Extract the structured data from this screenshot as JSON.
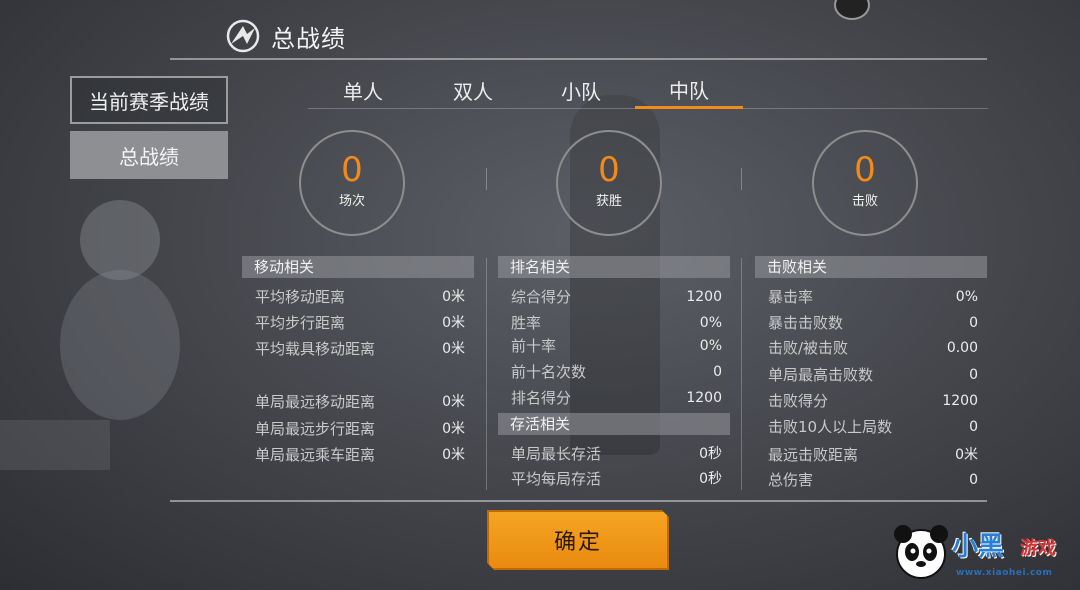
{
  "header": {
    "title": "总战绩"
  },
  "sidebar": {
    "season_label": "当前赛季战绩",
    "total_label": "总战绩"
  },
  "tabs": [
    "单人",
    "双人",
    "小队",
    "中队"
  ],
  "active_tab": "中队",
  "summary": [
    {
      "value": "0",
      "label": "场次"
    },
    {
      "value": "0",
      "label": "获胜"
    },
    {
      "value": "0",
      "label": "击败"
    }
  ],
  "movement": {
    "title": "移动相关",
    "rows": [
      {
        "k": "平均移动距离",
        "v": "0米"
      },
      {
        "k": "平均步行距离",
        "v": "0米"
      },
      {
        "k": "平均载具移动距离",
        "v": "0米"
      },
      {
        "k": "单局最远移动距离",
        "v": "0米"
      },
      {
        "k": "单局最远步行距离",
        "v": "0米"
      },
      {
        "k": "单局最远乘车距离",
        "v": "0米"
      }
    ]
  },
  "ranking": {
    "title": "排名相关",
    "rows": [
      {
        "k": "综合得分",
        "v": "1200"
      },
      {
        "k": "胜率",
        "v": "0%"
      },
      {
        "k": "前十率",
        "v": "0%"
      },
      {
        "k": "前十名次数",
        "v": "0"
      },
      {
        "k": "排名得分",
        "v": "1200"
      }
    ]
  },
  "survival": {
    "title": "存活相关",
    "rows": [
      {
        "k": "单局最长存活",
        "v": "0秒"
      },
      {
        "k": "平均每局存活",
        "v": "0秒"
      }
    ]
  },
  "kills": {
    "title": "击败相关",
    "rows": [
      {
        "k": "暴击率",
        "v": "0%"
      },
      {
        "k": "暴击击败数",
        "v": "0"
      },
      {
        "k": "击败/被击败",
        "v": "0.00"
      },
      {
        "k": "单局最高击败数",
        "v": "0"
      },
      {
        "k": "击败得分",
        "v": "1200"
      },
      {
        "k": "击败10人以上局数",
        "v": "0"
      },
      {
        "k": "最远击败距离",
        "v": "0米"
      },
      {
        "k": "总伤害",
        "v": "0"
      }
    ]
  },
  "confirm_label": "确定",
  "watermark": {
    "brand_a": "小黑",
    "brand_b": "游戏",
    "url": "www.xiaohei.com"
  },
  "colors": {
    "accent": "#f08c1c",
    "button": "#f0961a"
  }
}
